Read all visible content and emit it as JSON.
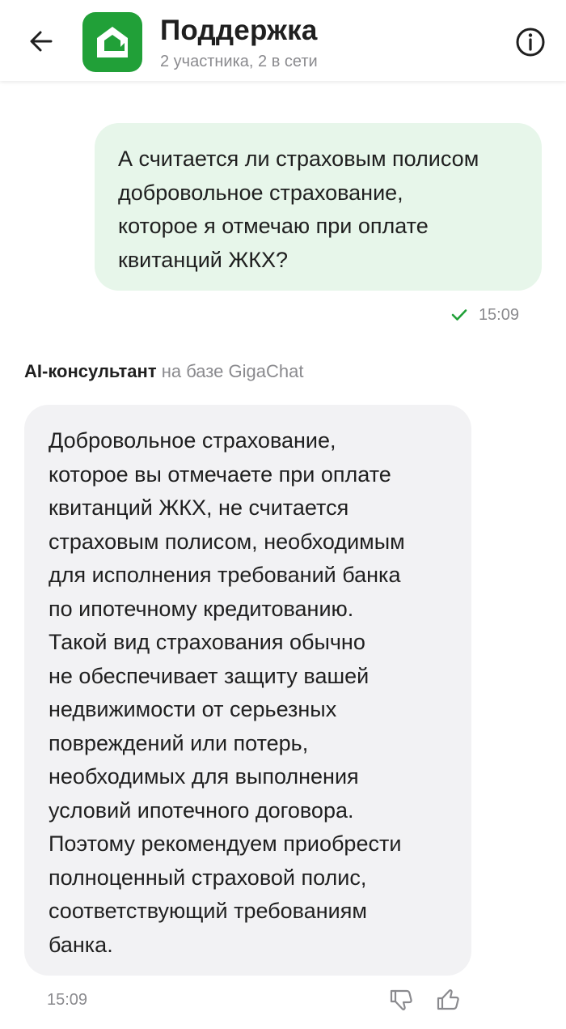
{
  "header": {
    "title": "Поддержка",
    "subtitle": "2 участника, 2 в сети",
    "back_icon": "arrow-left-icon",
    "info_icon": "info-circle-icon",
    "avatar_icon": "green-house-logo-icon"
  },
  "messages": {
    "outgoing": {
      "lines": [
        "А считается ли страховым полисом",
        "добровольное страхование,",
        "которое я отмечаю при оплате",
        "квитанций ЖКХ?"
      ],
      "time": "15:09",
      "status_icon": "checkmark-icon"
    },
    "incoming": {
      "sender": "AI-консультант",
      "sender_sub": "на базе GigaChat",
      "lines": [
        "Добровольное страхование,",
        "которое вы отмечаете при оплате",
        "квитанций ЖКХ, не считается",
        "страховым полисом, необходимым",
        "для исполнения требований банка",
        "по ипотечному кредитованию.",
        "Такой вид страхования обычно",
        "не обеспечивает защиту вашей",
        "недвижимости от серьезных",
        "повреждений или потерь,",
        "необходимых для выполнения",
        "условий ипотечного договора.",
        "Поэтому рекомендуем приобрести",
        "полноценный страховой полис,",
        "соответствующий требованиям",
        "банка."
      ],
      "time": "15:09"
    }
  },
  "colors": {
    "brand_green": "#21a038",
    "outgoing_bubble": "#e7f6ea",
    "incoming_bubble": "#f2f2f4",
    "check_green": "#21a038",
    "muted_text": "#8a8a8e"
  }
}
